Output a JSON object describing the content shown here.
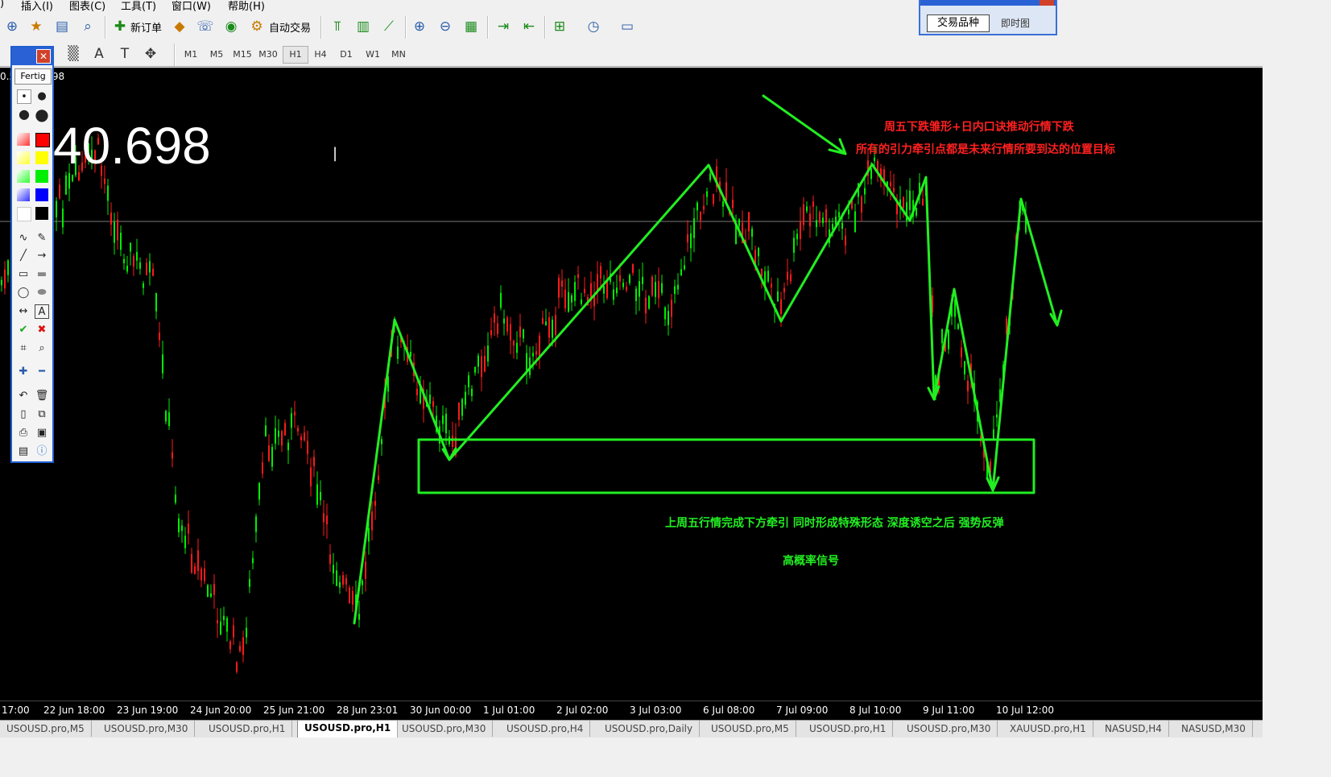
{
  "menu": {
    "insert": "插入(I)",
    "charts": "图表(C)",
    "tools": "工具(T)",
    "window": "窗口(W)",
    "help": "帮助(H)"
  },
  "toolbar": {
    "new_order": "新订单",
    "auto_trading": "自动交易"
  },
  "timeframes": [
    "M1",
    "M5",
    "M15",
    "M30",
    "H1",
    "H4",
    "D1",
    "W1",
    "MN"
  ],
  "active_timeframe": "H1",
  "palette": {
    "done_label": "Fertig",
    "text_tool": "A"
  },
  "popup": {
    "tab_symbols": "交易品种",
    "tab_tick": "即时图"
  },
  "chart": {
    "ohlc_text": "0.599 40.698",
    "big_price": "40.698",
    "annotations": {
      "red1": "周五下跌雏形+日内口诀推动行情下跌",
      "red2": "所有的引力牵引点都是未来行情所要到达的位置目标",
      "green1": "上周五行情完成下方牵引 同时形成特殊形态 深度诱空之后 强势反弹",
      "green2": "高概率信号"
    },
    "time_labels": [
      "17:00",
      "22 Jun 18:00",
      "23 Jun 19:00",
      "24 Jun 20:00",
      "25 Jun 21:00",
      "28 Jun 23:01",
      "30 Jun 00:00",
      "1 Jul 01:00",
      "2 Jul 02:00",
      "3 Jul 03:00",
      "6 Jul 08:00",
      "7 Jul 09:00",
      "8 Jul 10:00",
      "9 Jul 11:00",
      "10 Jul 12:00"
    ],
    "colors": {
      "bull": "#00ee00",
      "bear": "#ff1a1a",
      "drawing": "#22ee22"
    }
  },
  "tabs": [
    "USOUSD.pro,M5",
    "USOUSD.pro,M30",
    "USOUSD.pro,H1",
    "USOUSD.pro,H1",
    "USOUSD.pro,M30",
    "USOUSD.pro,H4",
    "USOUSD.pro,Daily",
    "USOUSD.pro,M5",
    "USOUSD.pro,H1",
    "USOUSD.pro,M30",
    "XAUUSD.pro,H1",
    "NASUSD,H4",
    "NASUSD,M30"
  ],
  "active_tab_index": 3
}
